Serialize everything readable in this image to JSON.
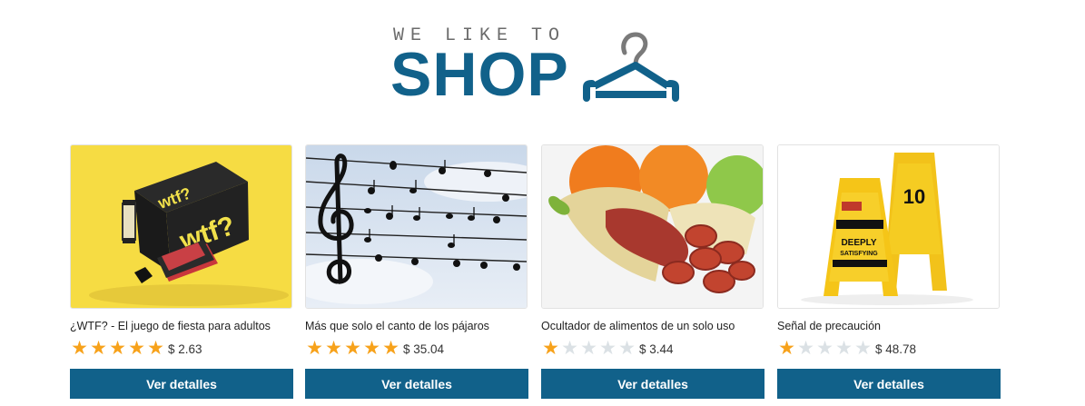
{
  "brand": {
    "tagline": "WE LIKE TO",
    "name": "SHOP",
    "color": "#11618a"
  },
  "accent": {
    "button": "#11618a",
    "star_on": "#f7a21b",
    "star_off": "#dbe1e5"
  },
  "products": [
    {
      "title": "¿WTF? - El juego de fiesta para adultos",
      "rating": 5,
      "price": "$ 2.63",
      "button_label": "Ver detalles"
    },
    {
      "title": "Más que solo el canto de los pájaros",
      "rating": 5,
      "price": "$ 35.04",
      "button_label": "Ver detalles"
    },
    {
      "title": "Ocultador de alimentos de un solo uso",
      "rating": 1,
      "price": "$ 3.44",
      "button_label": "Ver detalles"
    },
    {
      "title": "Señal de precaución",
      "rating": 1,
      "price": "$ 48.78",
      "button_label": "Ver detalles"
    }
  ],
  "images": [
    {
      "box_text": "wtf?",
      "card_text": ""
    },
    {},
    {},
    {
      "sign_text": "DEEPLY SATISFYING POO IN PROGRESS",
      "sign_text_2": "GIVE IT 10 MINUTES"
    }
  ]
}
